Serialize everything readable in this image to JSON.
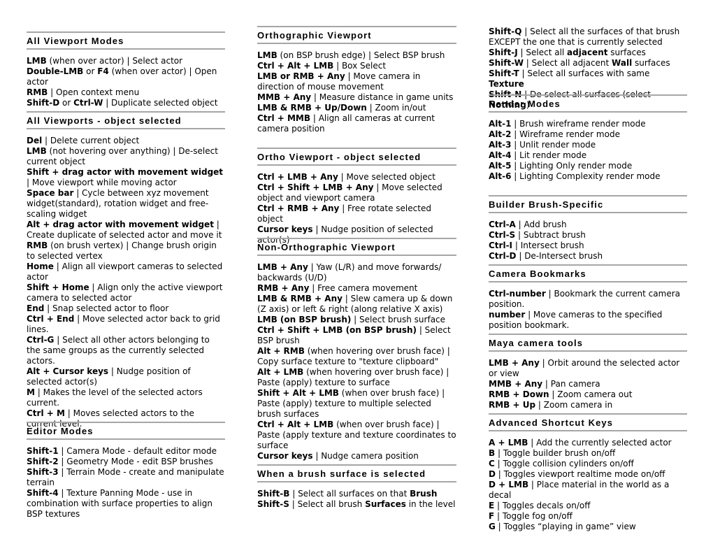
{
  "columns": [
    {
      "sections": [
        {
          "title": "All Viewport Modes",
          "entries": [
            [
              {
                "b": "LMB"
              },
              {
                "t": " (when over actor) | Select actor"
              }
            ],
            [
              {
                "b": "Double-LMB"
              },
              {
                "t": " or "
              },
              {
                "b": "F4"
              },
              {
                "t": " (when over actor) | Open actor"
              }
            ],
            [
              {
                "b": "RMB"
              },
              {
                "t": " | Open context menu"
              }
            ],
            [
              {
                "b": "Shift-D"
              },
              {
                "t": " or "
              },
              {
                "b": "Ctrl-W"
              },
              {
                "t": " | Duplicate selected object"
              }
            ]
          ]
        },
        {
          "title": "All Viewports - object selected",
          "entries": [
            [
              {
                "b": "Del"
              },
              {
                "t": " | Delete current object"
              }
            ],
            [
              {
                "b": "LMB"
              },
              {
                "t": " (not hovering over anything) | De-select current object"
              }
            ],
            [
              {
                "b": "Shift + drag actor with movement widget"
              },
              {
                "t": " | Move viewport while moving actor"
              }
            ],
            [
              {
                "b": "Space bar"
              },
              {
                "t": " | Cycle between xyz movement widget(standard), rotation widget and free-scaling widget"
              }
            ],
            [
              {
                "b": "Alt + drag actor with movement widget"
              },
              {
                "t": " | Create duplicate of selected actor and move it"
              }
            ],
            [
              {
                "b": "RMB"
              },
              {
                "t": " (on brush vertex) | Change brush origin to selected vertex"
              }
            ],
            [
              {
                "b": "Home"
              },
              {
                "t": " | Align all viewport cameras to selected actor"
              }
            ],
            [
              {
                "b": "Shift + Home"
              },
              {
                "t": " | Align only the active viewport camera to selected actor"
              }
            ],
            [
              {
                "b": "End"
              },
              {
                "t": " | Snap selected actor to floor"
              }
            ],
            [
              {
                "b": "Ctrl + End"
              },
              {
                "t": " | Move selected actor back to grid lines."
              }
            ],
            [
              {
                "b": "Ctrl-G"
              },
              {
                "t": " | Select all other actors belonging to the same groups as the currently selected actors."
              }
            ],
            [
              {
                "b": "Alt + Cursor keys"
              },
              {
                "t": " | Nudge position of selected actor(s)"
              }
            ],
            [
              {
                "b": "M"
              },
              {
                "t": " | Makes the level of the selected actors current."
              }
            ],
            [
              {
                "b": "Ctrl + M"
              },
              {
                "t": " | Moves selected actors to the current level."
              }
            ]
          ]
        },
        {
          "title": "Editor Modes",
          "entries": [
            [
              {
                "b": "Shift-1"
              },
              {
                "t": " | Camera Mode - default editor mode"
              }
            ],
            [
              {
                "b": "Shift-2"
              },
              {
                "t": " | Geometry Mode - edit BSP brushes"
              }
            ],
            [
              {
                "b": "Shift-3"
              },
              {
                "t": " | Terrain Mode - create and manipulate terrain"
              }
            ],
            [
              {
                "b": "Shift-4"
              },
              {
                "t": " | Texture Panning Mode - use in combination with surface properties to align BSP textures"
              }
            ]
          ]
        }
      ]
    },
    {
      "sections": [
        {
          "title": "Orthographic Viewport",
          "entries": [
            [
              {
                "b": "LMB"
              },
              {
                "t": " (on BSP brush edge) | Select BSP brush"
              }
            ],
            [
              {
                "b": "Ctrl + Alt + LMB"
              },
              {
                "t": " | Box Select"
              }
            ],
            [
              {
                "b": "LMB or RMB + Any"
              },
              {
                "t": " | Move camera in direction of mouse movement"
              }
            ],
            [
              {
                "b": "MMB + Any"
              },
              {
                "t": " | Measure distance in game units"
              }
            ],
            [
              {
                "b": "LMB & RMB + Up/Down"
              },
              {
                "t": " | Zoom in/out"
              }
            ],
            [
              {
                "b": "Ctrl + MMB"
              },
              {
                "t": " | Align all cameras at current camera position"
              }
            ]
          ]
        },
        {
          "title": "Ortho Viewport - object selected",
          "entries": [
            [
              {
                "b": "Ctrl + LMB + Any"
              },
              {
                "t": " | Move selected object"
              }
            ],
            [
              {
                "b": "Ctrl + Shift + LMB + Any"
              },
              {
                "t": " | Move selected object and viewport camera"
              }
            ],
            [
              {
                "b": "Ctrl + RMB + Any"
              },
              {
                "t": " | Free rotate selected object"
              }
            ],
            [
              {
                "b": "Cursor keys"
              },
              {
                "t": " | Nudge position of selected actor(s)"
              }
            ]
          ]
        },
        {
          "title": "Non-Orthographic Viewport",
          "entries": [
            [
              {
                "b": "LMB + Any"
              },
              {
                "t": " | Yaw (L/R) and move forwards/ backwards (U/D)"
              }
            ],
            [
              {
                "b": "RMB + Any"
              },
              {
                "t": " | Free camera movement"
              }
            ],
            [
              {
                "b": "LMB & RMB + Any"
              },
              {
                "t": " | Slew camera up & down (Z axis) or left & right (along relative X axis)"
              }
            ],
            [
              {
                "b": "LMB (on BSP brush)"
              },
              {
                "t": " | Select brush surface"
              }
            ],
            [
              {
                "b": "Ctrl + Shift + LMB (on BSP brush)"
              },
              {
                "t": " | Select BSP brush"
              }
            ],
            [
              {
                "b": "Alt + RMB"
              },
              {
                "t": " (when hovering over brush face) | Copy surface texture to \"texture clipboard\""
              }
            ],
            [
              {
                "b": "Alt + LMB"
              },
              {
                "t": " (when hovering over brush face) | Paste (apply) texture to surface"
              }
            ],
            [
              {
                "b": "Shift + Alt + LMB"
              },
              {
                "t": " (when over brush face) | Paste (apply) texture to multiple selected brush surfaces"
              }
            ],
            [
              {
                "b": "Ctrl + Alt + LMB"
              },
              {
                "t": " (when over brush face) | Paste (apply texture and texture coordinates to surface"
              }
            ],
            [
              {
                "b": "Cursor keys"
              },
              {
                "t": " | Nudge camera position"
              }
            ]
          ]
        },
        {
          "title": "When a brush surface is selected",
          "entries": [
            [
              {
                "b": "Shift-B"
              },
              {
                "t": " | Select all surfaces on that "
              },
              {
                "b": "Brush"
              }
            ],
            [
              {
                "b": "Shift-S"
              },
              {
                "t": " | Select all brush "
              },
              {
                "b": "Surfaces"
              },
              {
                "t": " in the level"
              }
            ]
          ]
        }
      ]
    },
    {
      "continued_entries": [
        [
          {
            "b": "Shift-Q"
          },
          {
            "t": " | Select all the surfaces of that brush EXCEPT the one that is currently selected"
          }
        ],
        [
          {
            "b": "Shift-J"
          },
          {
            "t": " | Select all "
          },
          {
            "b": "adjacent"
          },
          {
            "t": " surfaces"
          }
        ],
        [
          {
            "b": "Shift-W"
          },
          {
            "t": " | Select all adjacent "
          },
          {
            "b": "Wall"
          },
          {
            "t": " surfaces"
          }
        ],
        [
          {
            "b": "Shift-T"
          },
          {
            "t": " | Select all surfaces with same "
          },
          {
            "b": "Texture"
          }
        ],
        [
          {
            "b": "Shift-N"
          },
          {
            "t": " | De-select all surfaces (select "
          },
          {
            "b": "Nothing"
          },
          {
            "t": ")"
          }
        ]
      ],
      "sections": [
        {
          "title": "Render Modes",
          "entries": [
            [
              {
                "b": "Alt-1"
              },
              {
                "t": " | Brush wireframe render mode"
              }
            ],
            [
              {
                "b": "Alt-2"
              },
              {
                "t": " | Wireframe render mode"
              }
            ],
            [
              {
                "b": "Alt-3"
              },
              {
                "t": " | Unlit render mode"
              }
            ],
            [
              {
                "b": "Alt-4"
              },
              {
                "t": " | Lit render mode"
              }
            ],
            [
              {
                "b": "Alt-5"
              },
              {
                "t": " | Lighting Only render mode"
              }
            ],
            [
              {
                "b": "Alt-6"
              },
              {
                "t": " | Lighting Complexity render mode"
              }
            ]
          ]
        },
        {
          "title": "Builder Brush-Specific",
          "entries": [
            [
              {
                "b": "Ctrl-A"
              },
              {
                "t": " | Add brush"
              }
            ],
            [
              {
                "b": "Ctrl-S"
              },
              {
                "t": " | Subtract brush"
              }
            ],
            [
              {
                "b": "Ctrl-I"
              },
              {
                "t": " | Intersect brush"
              }
            ],
            [
              {
                "b": "Ctrl-D"
              },
              {
                "t": " | De-Intersect brush"
              }
            ]
          ]
        },
        {
          "title": "Camera Bookmarks",
          "entries": [
            [
              {
                "b": "Ctrl-number"
              },
              {
                "t": " | Bookmark the current camera position."
              }
            ],
            [
              {
                "b": "number"
              },
              {
                "t": " | Move cameras to the specified position bookmark."
              }
            ]
          ]
        },
        {
          "title": "Maya camera tools",
          "entries": [
            [
              {
                "b": "LMB + Any"
              },
              {
                "t": " | Orbit around the selected actor or view"
              }
            ],
            [
              {
                "b": "MMB + Any"
              },
              {
                "t": " | Pan camera"
              }
            ],
            [
              {
                "b": "RMB + Down"
              },
              {
                "t": " | Zoom camera out"
              }
            ],
            [
              {
                "b": "RMB + Up"
              },
              {
                "t": " | Zoom camera in"
              }
            ]
          ]
        },
        {
          "title": "Advanced Shortcut Keys",
          "entries": [
            [
              {
                "b": "A + LMB"
              },
              {
                "t": " | Add the currently selected actor"
              }
            ],
            [
              {
                "b": "B"
              },
              {
                "t": " | Toggle builder brush on/off"
              }
            ],
            [
              {
                "b": "C"
              },
              {
                "t": " | Toggle collision cylinders on/off"
              }
            ],
            [
              {
                "b": "D"
              },
              {
                "t": " | Toggles viewport realtime mode on/off"
              }
            ],
            [
              {
                "b": "D + LMB"
              },
              {
                "t": " | Place material in the world as a decal"
              }
            ],
            [
              {
                "b": "E"
              },
              {
                "t": " | Toggles decals on/off"
              }
            ],
            [
              {
                "b": "F"
              },
              {
                "t": " | Toggle fog on/off"
              }
            ],
            [
              {
                "b": "G"
              },
              {
                "t": " | Toggles “playing in game” view"
              }
            ]
          ]
        }
      ]
    }
  ]
}
